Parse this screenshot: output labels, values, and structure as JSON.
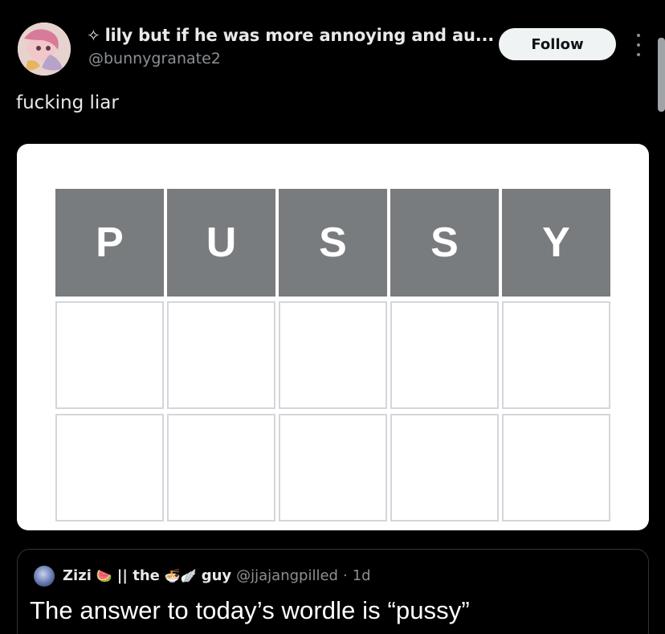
{
  "author": {
    "display_name": "lily but if he was more annoying and au...",
    "name_prefix_icon": "sparkle-icon",
    "name_prefix_glyph": "✧",
    "handle": "@bunnygranate2"
  },
  "follow_label": "Follow",
  "tweet_text": "fucking liar",
  "wordle": {
    "rows": [
      [
        "P",
        "U",
        "S",
        "S",
        "Y"
      ],
      [
        "",
        "",
        "",
        "",
        ""
      ],
      [
        "",
        "",
        "",
        "",
        ""
      ]
    ],
    "filled_color": "#787c7e",
    "empty_border_color": "#d3d6da"
  },
  "quoted_tweet": {
    "name_part1": "Zizi",
    "emoji1": "🍉",
    "name_part2": "|| the",
    "emoji2": "🍜🪽",
    "name_part3": "guy",
    "handle": "@jjajangpilled",
    "separator": "·",
    "time": "1d",
    "text": "The answer to today’s wordle is “pussy”"
  },
  "colors": {
    "background": "#000000",
    "text_primary": "#e7e9ea",
    "text_secondary": "#8b9095",
    "follow_bg": "#eff3f4"
  }
}
